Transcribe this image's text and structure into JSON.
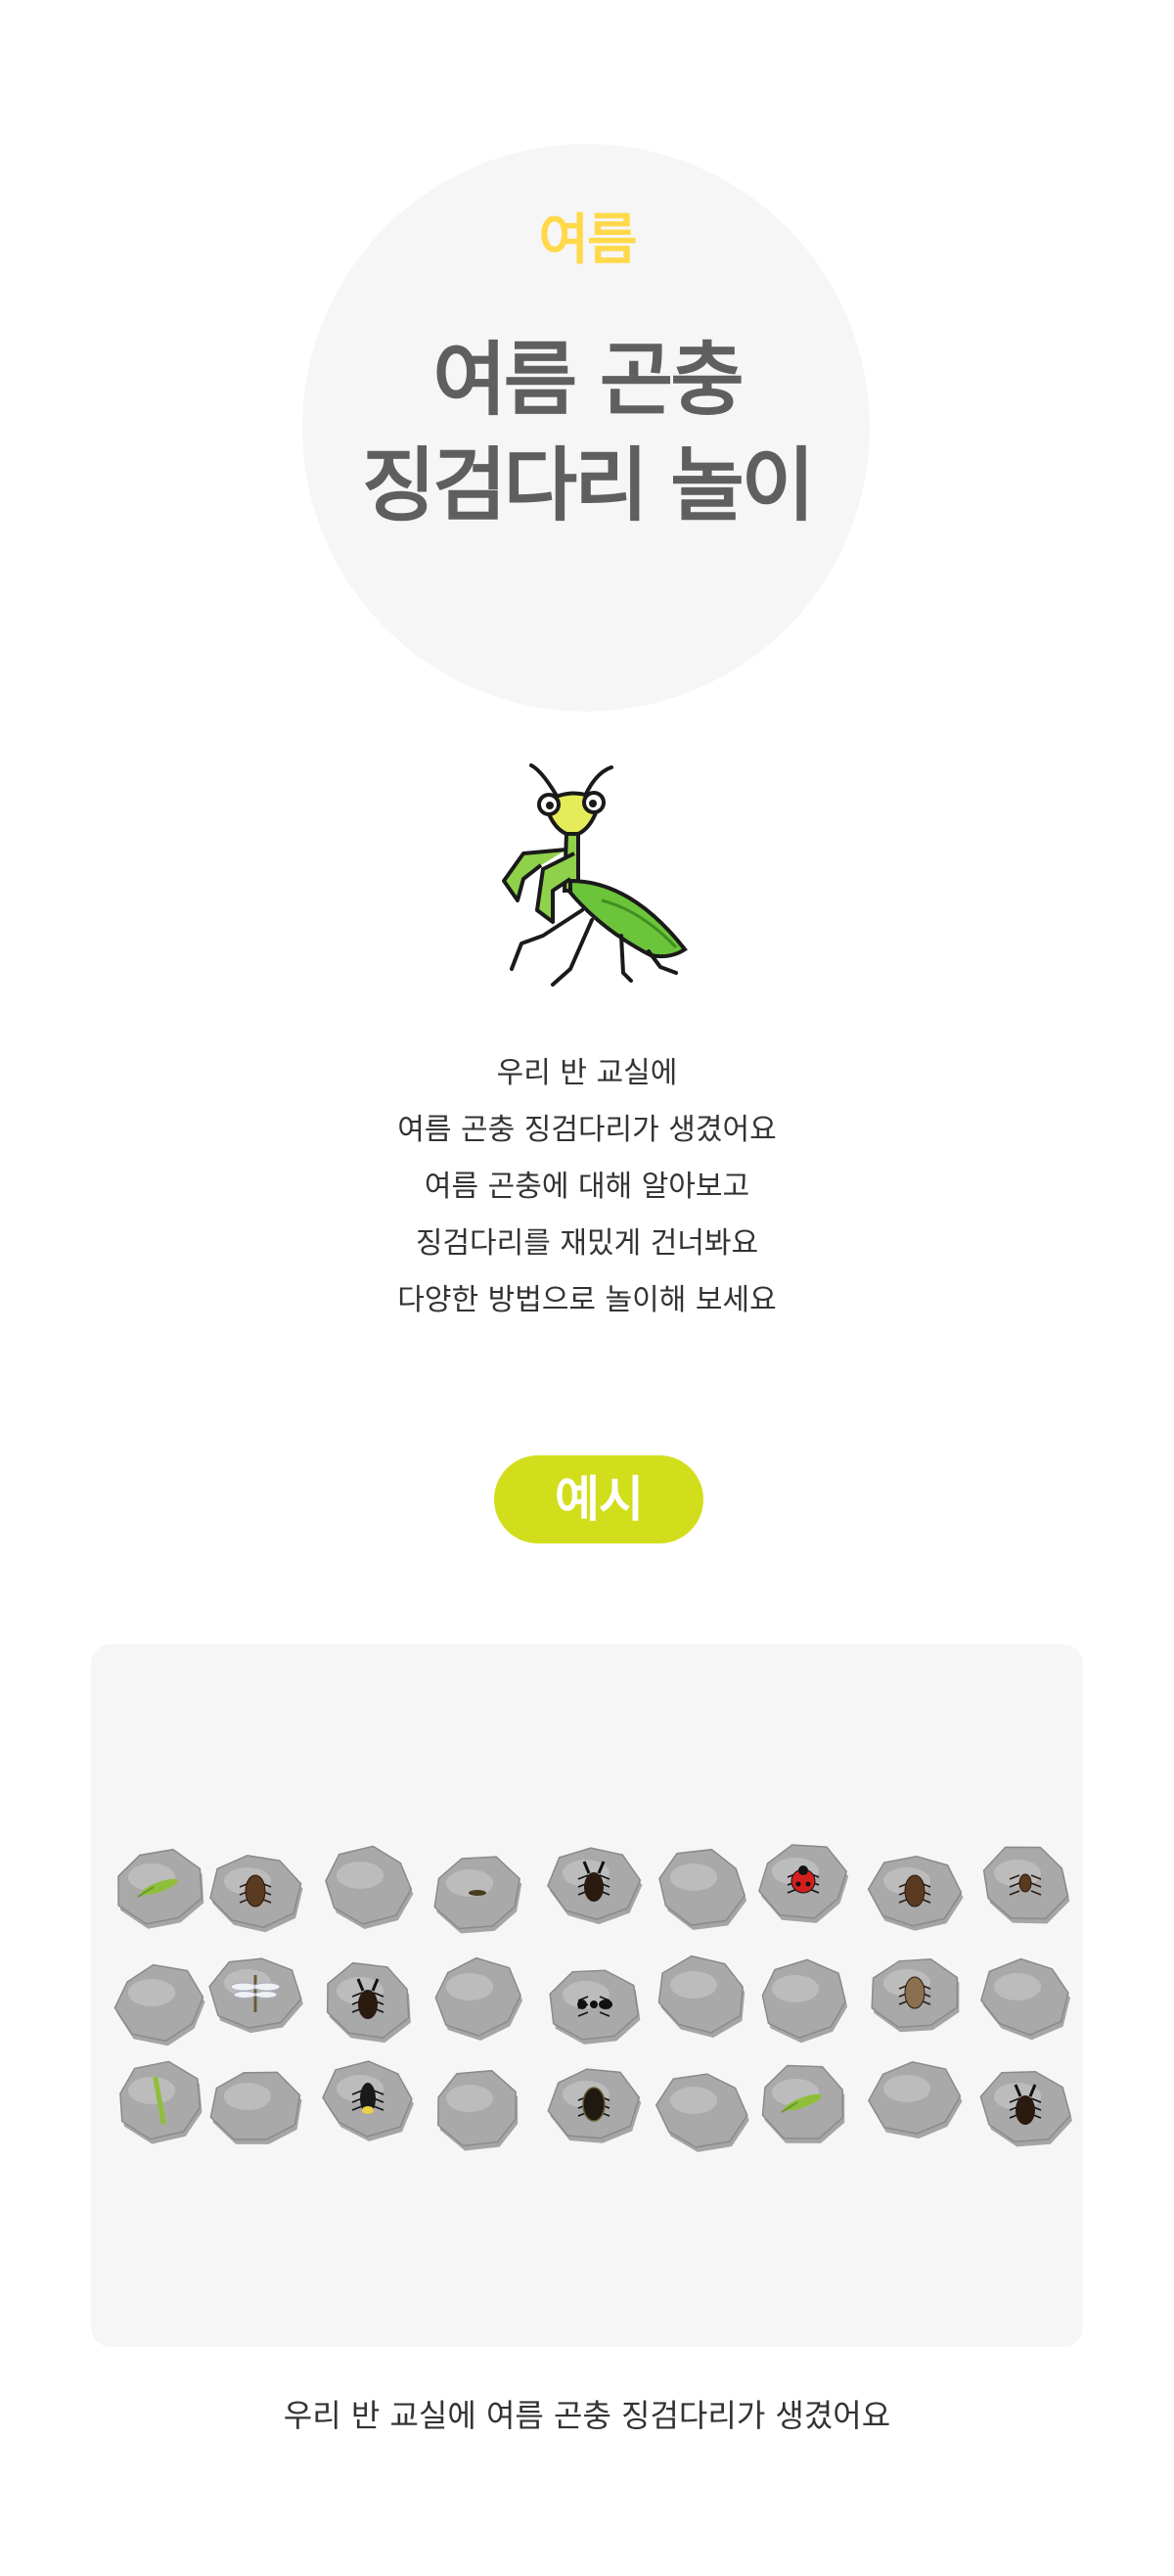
{
  "hero": {
    "season": "여름",
    "title_line1": "여름 곤충",
    "title_line2": "징검다리 놀이"
  },
  "illustration": {
    "icon": "praying-mantis-icon"
  },
  "intro": {
    "lines": [
      "우리 반 교실에",
      "여름 곤충 징검다리가 생겼어요",
      "여름 곤충에 대해 알아보고",
      "징검다리를 재밌게 건너봐요",
      "다양한 방법으로 놀이해 보세요"
    ]
  },
  "example": {
    "label": "예시",
    "caption": "우리 반 교실에 여름 곤충 징검다리가 생겼어요",
    "rows": [
      [
        "grasshopper",
        "beetle",
        "",
        "small-bug",
        "stag-beetle",
        "",
        "ladybug",
        "stink-bug",
        "small-beetle"
      ],
      [
        "",
        "dragonfly",
        "rhinoceros-beetle",
        "",
        "ant",
        "",
        "",
        "cicada",
        ""
      ],
      [
        "mantis",
        "",
        "firefly",
        "",
        "diving-beetle",
        "",
        "grasshopper",
        "",
        "stag-beetle"
      ]
    ]
  },
  "colors": {
    "season_accent": "#ffd94a",
    "example_pill": "#d2de1c",
    "title_gray": "#5f5f5f",
    "panel_bg": "#f6f6f6"
  }
}
